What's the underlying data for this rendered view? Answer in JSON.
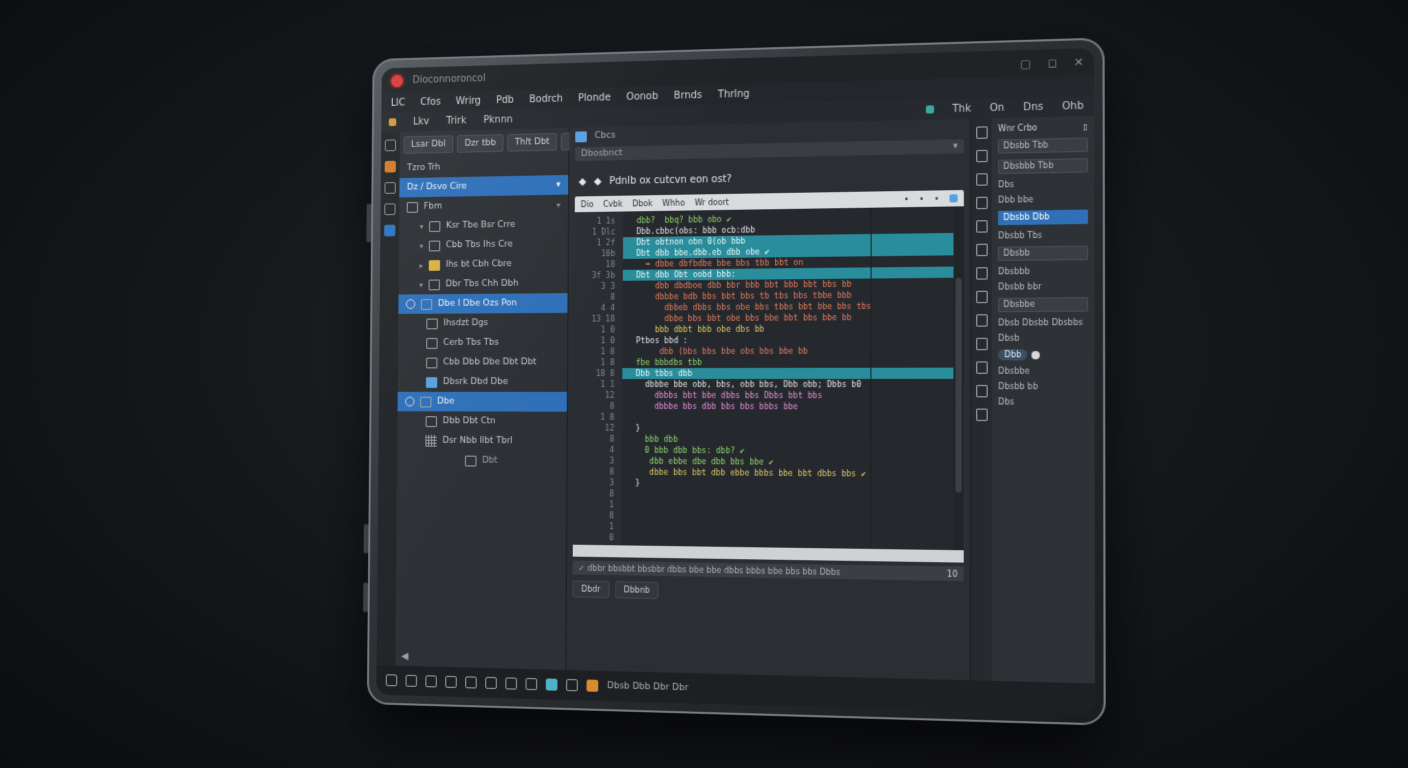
{
  "window": {
    "title": "Dioconnoroncol",
    "controls": [
      "▢",
      "◻",
      "✕"
    ]
  },
  "menubar": [
    "LIC",
    "Cfos",
    "Wrirg",
    "Pdb",
    "Bodrch",
    "Plonde",
    "Oonob",
    "Brnds",
    "Thrlng"
  ],
  "toolbar2": {
    "left": [
      "Lkv",
      "Trirk",
      "Pknnn"
    ],
    "right": [
      "Thk",
      "On",
      "Dns",
      "Ohb"
    ]
  },
  "sidebar": {
    "tabs": [
      "Lsar Dbl",
      "Dzr tbb",
      "Thlt Dbt",
      "Wth"
    ],
    "header": "Tzro Trh",
    "search": "Dz / Dsvo Cire",
    "group": "Fbm",
    "items": [
      "Ksr Tbe Bsr Crre",
      "Cbb Tbs Ihs Cre",
      "Ihs bt Cbh Cbre",
      "Dbr Tbs Chh Dbh",
      "Dbe I Dbe Ozs Pon",
      "Ihsdzt Dgs",
      "Cerb Tbs Tbs",
      "Cbb Dbb Dbe Dbt Dbt",
      "Dbsrk Dbd Dbe",
      "Dbe",
      "Dbb Dbt Ctn",
      "Dsr Nbb Ilbt Tbrl",
      "Dbt"
    ]
  },
  "main": {
    "topbar": "Cbcs",
    "address": "Dbosbnct",
    "heading": "Pdnlb ox cutcvn eon ost?",
    "editor_tabs": [
      "Dio",
      "Cvbk",
      "Dbok",
      "Whho",
      "Wr doort"
    ],
    "line_numbers": [
      "1 1s",
      "1 Dlc",
      "1 2f",
      "10b",
      "18",
      "3f 3b",
      "3 3",
      "8",
      "4 4",
      "13 18",
      "1 0",
      "1 0",
      "1 8",
      "1 8",
      "18 8",
      "1 1",
      "12",
      "8",
      "1 8",
      "12",
      "8",
      "4",
      "3",
      "8",
      "3",
      "8",
      "1",
      "8",
      "1",
      "0"
    ],
    "code_lines": [
      {
        "t": "  dbb?  bbq? bbb obo ✔",
        "hl": false,
        "c": "kw"
      },
      {
        "t": "  Dbb.cbbc(obs: bbb ocb:dbb",
        "hl": false,
        "c": "wt"
      },
      {
        "t": "  Dbt obtnon obn 0(ob bbb",
        "hl": true,
        "c": "cy"
      },
      {
        "t": "  Dbt dbb bbe.dbb.eb dbb obe ✔",
        "hl": true,
        "c": "cy"
      },
      {
        "t": "    ➥ dbbe dbfbdbe bbe bbs tbb bbt on",
        "hl": false,
        "c": "str"
      },
      {
        "t": "  Dbt dbb Obt oobd bbb:",
        "hl": true,
        "c": "cy"
      },
      {
        "t": "      dbb dbdboe dbb bbr bbb bbt bbb bbt bbs bb",
        "hl": false,
        "c": "str"
      },
      {
        "t": "      dbbbe bdb bbs bbt bbs tb tbs bbs tbbe bbb",
        "hl": false,
        "c": "str"
      },
      {
        "t": "        dbbeb dbbs bbs obe bbs tbbs bbt bbe bbs tbs",
        "hl": false,
        "c": "str"
      },
      {
        "t": "        dbbe bbs bbt obe bbs bbe bbt bbs bbe bb",
        "hl": false,
        "c": "str"
      },
      {
        "t": "      bbb dbbt bbb obe dbs bb",
        "hl": false,
        "c": "fn"
      },
      {
        "t": "  Ptbos bbd :",
        "hl": false,
        "c": "wt"
      },
      {
        "t": "       dbb (bbs bbs bbe obs bbs bbe bb",
        "hl": false,
        "c": "str"
      },
      {
        "t": "  fbe bbbdbs tbb",
        "hl": false,
        "c": "kw"
      },
      {
        "t": "  Dbb tbbs dbb",
        "hl": true,
        "c": "cy"
      },
      {
        "t": "    dbbbe bbe obb, bbs, obb bbs, Dbb obb; Dbbs b0",
        "hl": false,
        "c": "wt"
      },
      {
        "t": "      dbbbs bbt bbe dbbs bbs Dbbs bbt bbs",
        "hl": false,
        "c": "pk"
      },
      {
        "t": "      dbbbe bbs dbb bbs bbs bbbs bbe",
        "hl": false,
        "c": "pk"
      },
      {
        "t": "",
        "hl": false,
        "c": "wt"
      },
      {
        "t": "  }",
        "hl": false,
        "c": "wt"
      },
      {
        "t": "    bbb dbb",
        "hl": false,
        "c": "kw"
      },
      {
        "t": "    0 bbb dbb bbs: dbb? ✔",
        "hl": false,
        "c": "kw"
      },
      {
        "t": "     dbb ebbe dbe dbb bbs bbe ✔",
        "hl": false,
        "c": "kw"
      },
      {
        "t": "     dbbe bbs bbt dbb ebbe bbbs bbe bbt dbbs bbs ✔",
        "hl": false,
        "c": "fn"
      },
      {
        "t": "  }",
        "hl": false,
        "c": "wt"
      },
      {
        "t": "",
        "hl": false,
        "c": "wt"
      },
      {
        "t": "",
        "hl": false,
        "c": "wt"
      },
      {
        "t": "",
        "hl": false,
        "c": "wt"
      },
      {
        "t": "",
        "hl": false,
        "c": "wt"
      },
      {
        "t": "",
        "hl": false,
        "c": "wt"
      }
    ],
    "command": "✓ dbbr bbsbbt bbsbbr dbbs bbe bbe dbbs bbbs bbe bbs bbs Dbbs",
    "page": "10",
    "buttons": [
      "Dbdr",
      "Dbbnb"
    ]
  },
  "properties": {
    "header": "Wnr Crbo",
    "fields": [
      "Dbsbb Tbb",
      "Dbsbbb Tbb",
      "Dbs",
      "Dbb bbe",
      "Dbsbb Tbs",
      "Dbsbb",
      "Dbsbbb",
      "Dbsbb Dbb",
      "Dbsbb bbr",
      "Dbsbbe",
      "Dbsbbe",
      "Dbsbb bb",
      "Dbs"
    ],
    "selected_field": "Dbsbb Dbb",
    "row_labels": [
      "Dbsb",
      "Dbsbb",
      "Dbsbbs"
    ],
    "toggle_label": "Dbsb",
    "pill": "Dbb"
  },
  "taskbar": {
    "label": "Dbsb Dbb Dbr Dbr"
  },
  "colors": {
    "accent": "#2f70b8",
    "highlight": "#2a8d9b",
    "record": "#d83b3b"
  }
}
